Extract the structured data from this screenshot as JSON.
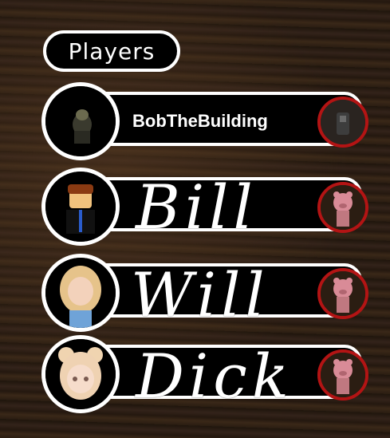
{
  "panel": {
    "title": "Players"
  },
  "players": [
    {
      "name": "BobTheBuilding",
      "handwritten": false
    },
    {
      "name": "Bill",
      "handwritten": true
    },
    {
      "name": "Will",
      "handwritten": true
    },
    {
      "name": "Dick",
      "handwritten": true
    }
  ],
  "colors": {
    "role_ring": "#b31414",
    "piggy_pink": "#d98b97",
    "bar_border": "#ffffff",
    "bar_fill": "#000000"
  },
  "icons": [
    "survivor-role-icon",
    "piggy-role-icon"
  ]
}
